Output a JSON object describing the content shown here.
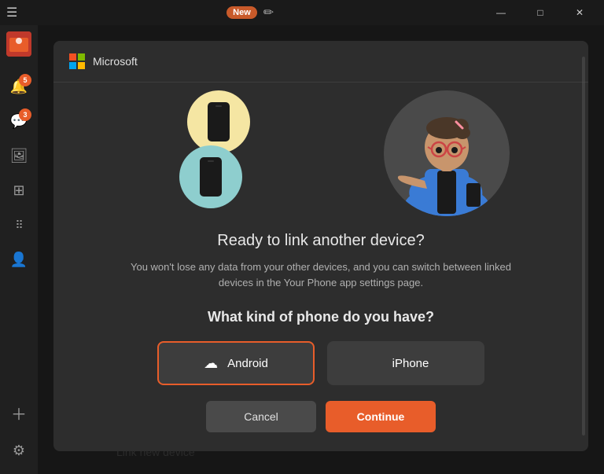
{
  "window": {
    "new_badge": "New",
    "minimize_icon": "—",
    "maximize_icon": "□",
    "close_icon": "✕"
  },
  "sidebar": {
    "avatar_alt": "Phone photo",
    "items": [
      {
        "name": "notifications",
        "icon": "🔔",
        "badge": "5"
      },
      {
        "name": "messages",
        "icon": "💬",
        "badge": "3"
      },
      {
        "name": "photos",
        "icon": "🖼"
      },
      {
        "name": "apps",
        "icon": "⊞"
      },
      {
        "name": "grid",
        "icon": "⋮⋮⋮"
      },
      {
        "name": "contacts",
        "icon": "👤"
      }
    ],
    "bottom_items": [
      {
        "name": "add",
        "icon": "＋"
      },
      {
        "name": "settings",
        "icon": "⚙"
      }
    ]
  },
  "background": {
    "link_text": "Link new device"
  },
  "modal": {
    "brand": "Microsoft",
    "illustration_alt": "Device linking illustration",
    "title": "Ready to link another device?",
    "description": "You won't lose any data from your other devices, and you can switch between linked devices in the Your Phone app settings page.",
    "question": "What kind of phone do you have?",
    "android_label": "Android",
    "iphone_label": "iPhone",
    "cancel_label": "Cancel",
    "continue_label": "Continue"
  }
}
